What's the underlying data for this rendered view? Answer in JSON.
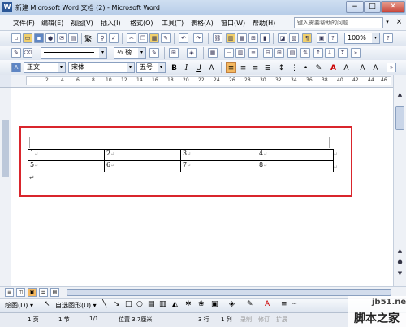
{
  "window": {
    "title": "新建 Microsoft Word 文档 (2) - Microsoft Word",
    "app_icon": "W",
    "minimize": "−",
    "maximize": "□",
    "close": "✕"
  },
  "menu": {
    "items": [
      "文件(F)",
      "编辑(E)",
      "视图(V)",
      "插入(I)",
      "格式(O)",
      "工具(T)",
      "表格(A)",
      "窗口(W)",
      "帮助(H)"
    ],
    "help_placeholder": "键入需要帮助的问题",
    "doc_close": "×"
  },
  "toolbar1": {
    "zoom": "100%",
    "traditional_label": "繁"
  },
  "toolbar2": {
    "line_weight": "½ 磅"
  },
  "formatting": {
    "style": "正文",
    "font": "宋体",
    "size": "五号",
    "bold": "B",
    "italic": "I",
    "underline": "U",
    "font_color_letter": "A"
  },
  "ruler": {
    "numbers": [
      "2",
      "4",
      "6",
      "8",
      "10",
      "12",
      "14",
      "16",
      "18",
      "20",
      "22",
      "24",
      "26",
      "28",
      "30",
      "32",
      "34",
      "36",
      "38",
      "40",
      "42",
      "44",
      "46",
      "48"
    ]
  },
  "table": {
    "rows": [
      [
        "1",
        "2",
        "3",
        "4"
      ],
      [
        "5",
        "6",
        "7",
        "8"
      ]
    ],
    "cell_mark": "↵"
  },
  "drawbar": {
    "draw_label": "绘图(D) ▾",
    "autoshape_label": "自选图形(U) ▾"
  },
  "status": {
    "page": "1 页",
    "section": "1 节",
    "page_of": "1/1",
    "position": "位置 3.7厘米",
    "line": "3 行",
    "column": "1 列",
    "rec": "录制",
    "trk": "修订",
    "ext": "扩展"
  },
  "watermark": {
    "line1": "jb51.net",
    "line2": "脚本之家"
  },
  "colors": {
    "highlight_box": "#d9252c",
    "title_bar": "#b7cde8"
  }
}
